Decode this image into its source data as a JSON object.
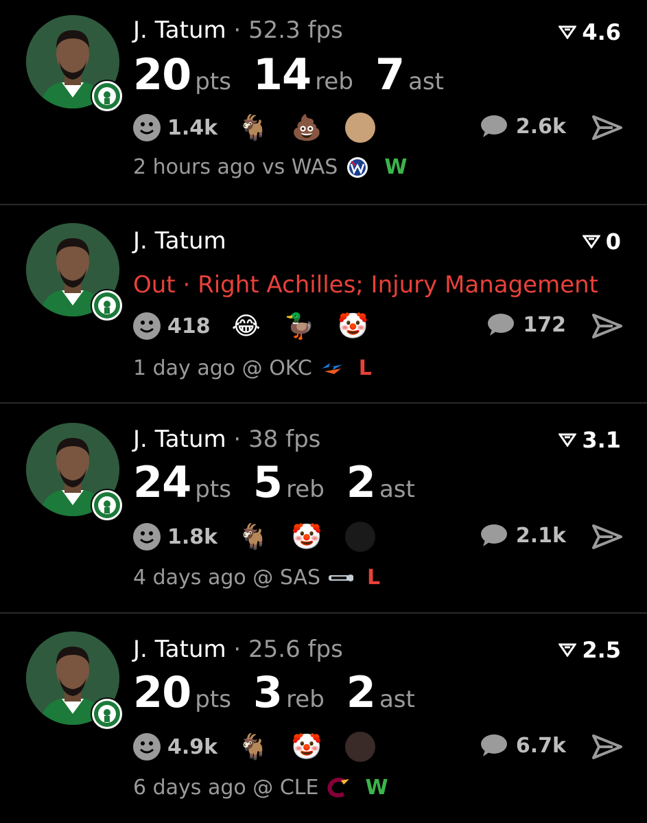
{
  "colors": {
    "win": "#3cb44a",
    "loss": "#e8413a",
    "muted": "#9b9b9b"
  },
  "posts": [
    {
      "player": "J. Tatum",
      "fps_label": " · 52.3 fps",
      "score": "4.6",
      "stats": {
        "pts": "20",
        "reb": "14",
        "ast": "7"
      },
      "units": {
        "pts": "pts",
        "reb": "reb",
        "ast": "ast"
      },
      "injury": "",
      "reaction_count": "1.4k",
      "reactions": [
        "🐐",
        "💩",
        "person-photo-icon"
      ],
      "comment_count": "2.6k",
      "meta": "2 hours ago vs WAS",
      "team_icon": "wizards-logo-icon",
      "result": "W"
    },
    {
      "player": "J. Tatum",
      "fps_label": "",
      "score": "0",
      "stats": null,
      "injury": "Out · Right Achilles; Injury Management",
      "reaction_count": "418",
      "reactions": [
        "😂",
        "🦆",
        "🤡"
      ],
      "comment_count": "172",
      "meta": "1 day ago @ OKC",
      "team_icon": "thunder-logo-icon",
      "result": "L"
    },
    {
      "player": "J. Tatum",
      "fps_label": " · 38 fps",
      "score": "3.1",
      "stats": {
        "pts": "24",
        "reb": "5",
        "ast": "2"
      },
      "units": {
        "pts": "pts",
        "reb": "reb",
        "ast": "ast"
      },
      "injury": "",
      "reaction_count": "1.8k",
      "reactions": [
        "🐐",
        "🤡",
        "player-photo-icon"
      ],
      "comment_count": "2.1k",
      "meta": "4 days ago @ SAS",
      "team_icon": "spurs-logo-icon",
      "result": "L"
    },
    {
      "player": "J. Tatum",
      "fps_label": " · 25.6 fps",
      "score": "2.5",
      "stats": {
        "pts": "20",
        "reb": "3",
        "ast": "2"
      },
      "units": {
        "pts": "pts",
        "reb": "reb",
        "ast": "ast"
      },
      "injury": "",
      "reaction_count": "4.9k",
      "reactions": [
        "🐐",
        "🤡",
        "person-photo-icon"
      ],
      "comment_count": "6.7k",
      "meta": "6 days ago @ CLE",
      "team_icon": "cavaliers-logo-icon",
      "result": "W"
    }
  ]
}
